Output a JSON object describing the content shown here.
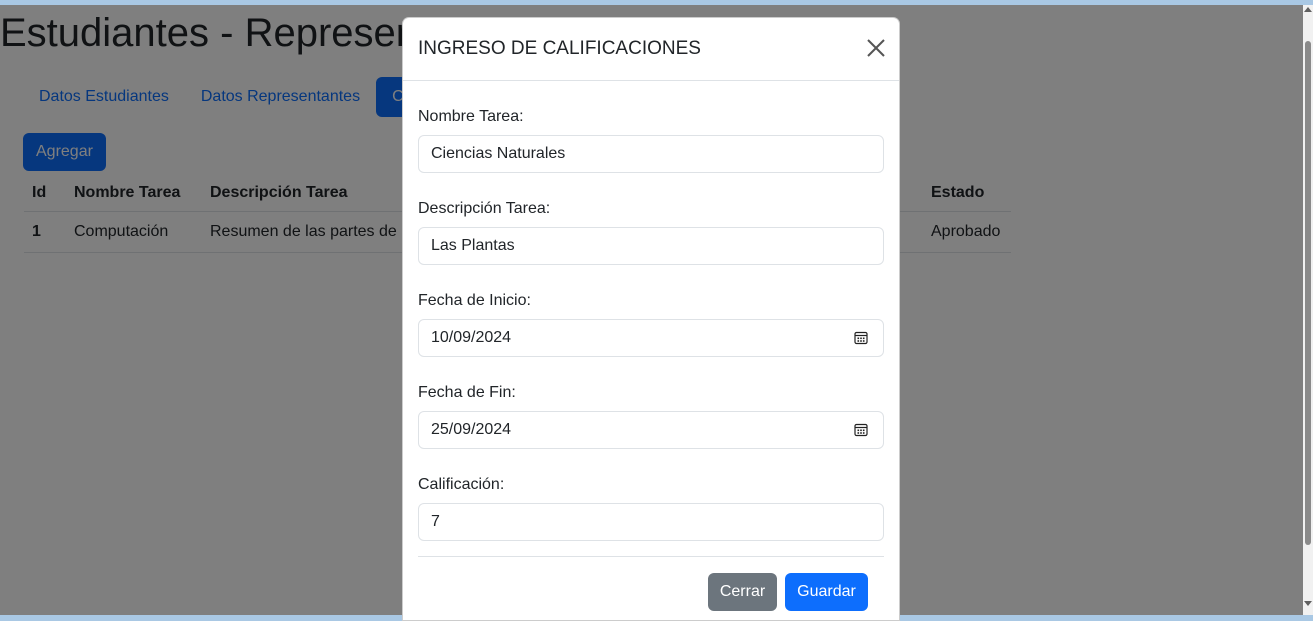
{
  "page": {
    "title": "Estudiantes - Representantes - Calificaciones",
    "tabs": [
      {
        "label": "Datos Estudiantes",
        "active": false
      },
      {
        "label": "Datos Representantes",
        "active": false
      },
      {
        "label": "Ca",
        "active": true
      }
    ],
    "add_button": "Agregar",
    "table": {
      "headers": {
        "id": "Id",
        "name": "Nombre Tarea",
        "desc": "Descripción Tarea",
        "status": "Estado"
      },
      "rows": [
        {
          "id": "1",
          "name": "Computación",
          "desc": "Resumen de las partes de un",
          "status": "Aprobado"
        }
      ]
    }
  },
  "modal": {
    "title": "INGRESO DE CALIFICACIONES",
    "fields": {
      "task_name": {
        "label": "Nombre Tarea:",
        "value": "Ciencias Naturales"
      },
      "task_desc": {
        "label": "Descripción Tarea:",
        "value": "Las Plantas"
      },
      "start_date": {
        "label": "Fecha de Inicio:",
        "value": "10/09/2024"
      },
      "end_date": {
        "label": "Fecha de Fin:",
        "value": "25/09/2024"
      },
      "grade": {
        "label": "Calificación:",
        "value": "7"
      }
    },
    "buttons": {
      "close": "Cerrar",
      "save": "Guardar"
    }
  },
  "icons": {
    "close": "close-icon",
    "calendar": "calendar-icon"
  },
  "colors": {
    "primary": "#0d6efd",
    "secondary": "#6c757d",
    "overlay": "rgba(0,0,0,0.5)"
  }
}
